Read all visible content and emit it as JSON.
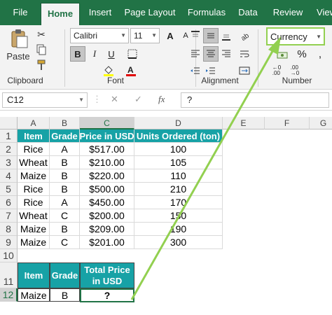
{
  "tabs": [
    "File",
    "Home",
    "Insert",
    "Page Layout",
    "Formulas",
    "Data",
    "Review",
    "View"
  ],
  "ribbon": {
    "clipboard": {
      "paste_label": "Paste",
      "group_label": "Clipboard"
    },
    "font": {
      "font_name": "Calibri",
      "font_size": "11",
      "bold": "B",
      "italic": "I",
      "underline": "U",
      "grow": "A",
      "shrink": "A",
      "group_label": "Font"
    },
    "alignment": {
      "group_label": "Alignment"
    },
    "number": {
      "format": "Currency",
      "percent": "%",
      "group_label": "Number"
    }
  },
  "formula_bar": {
    "name_box": "C12",
    "cancel": "✕",
    "enter": "✓",
    "fx": "fx",
    "formula": "?"
  },
  "columns": [
    "A",
    "B",
    "C",
    "D",
    "E",
    "F",
    "G"
  ],
  "rows": [
    "1",
    "2",
    "3",
    "4",
    "5",
    "6",
    "7",
    "8",
    "9",
    "10",
    "11",
    "12"
  ],
  "table1": {
    "headers": [
      "Item",
      "Grade",
      "Price in USD",
      "Units Ordered (ton)"
    ],
    "rows": [
      [
        "Rice",
        "A",
        "$517.00",
        "100"
      ],
      [
        "Wheat",
        "B",
        "$210.00",
        "105"
      ],
      [
        "Maize",
        "B",
        "$220.00",
        "110"
      ],
      [
        "Rice",
        "B",
        "$500.00",
        "210"
      ],
      [
        "Rice",
        "A",
        "$450.00",
        "170"
      ],
      [
        "Wheat",
        "C",
        "$200.00",
        "150"
      ],
      [
        "Maize",
        "B",
        "$209.00",
        "190"
      ],
      [
        "Maize",
        "C",
        "$201.00",
        "300"
      ]
    ]
  },
  "table2": {
    "headers": [
      "Item",
      "Grade",
      "Total Price in USD"
    ],
    "row": [
      "Maize",
      "B",
      "?"
    ]
  },
  "colors": {
    "excel_green": "#217346",
    "header_teal": "#17a2a6",
    "arrow_green": "#92d050"
  }
}
